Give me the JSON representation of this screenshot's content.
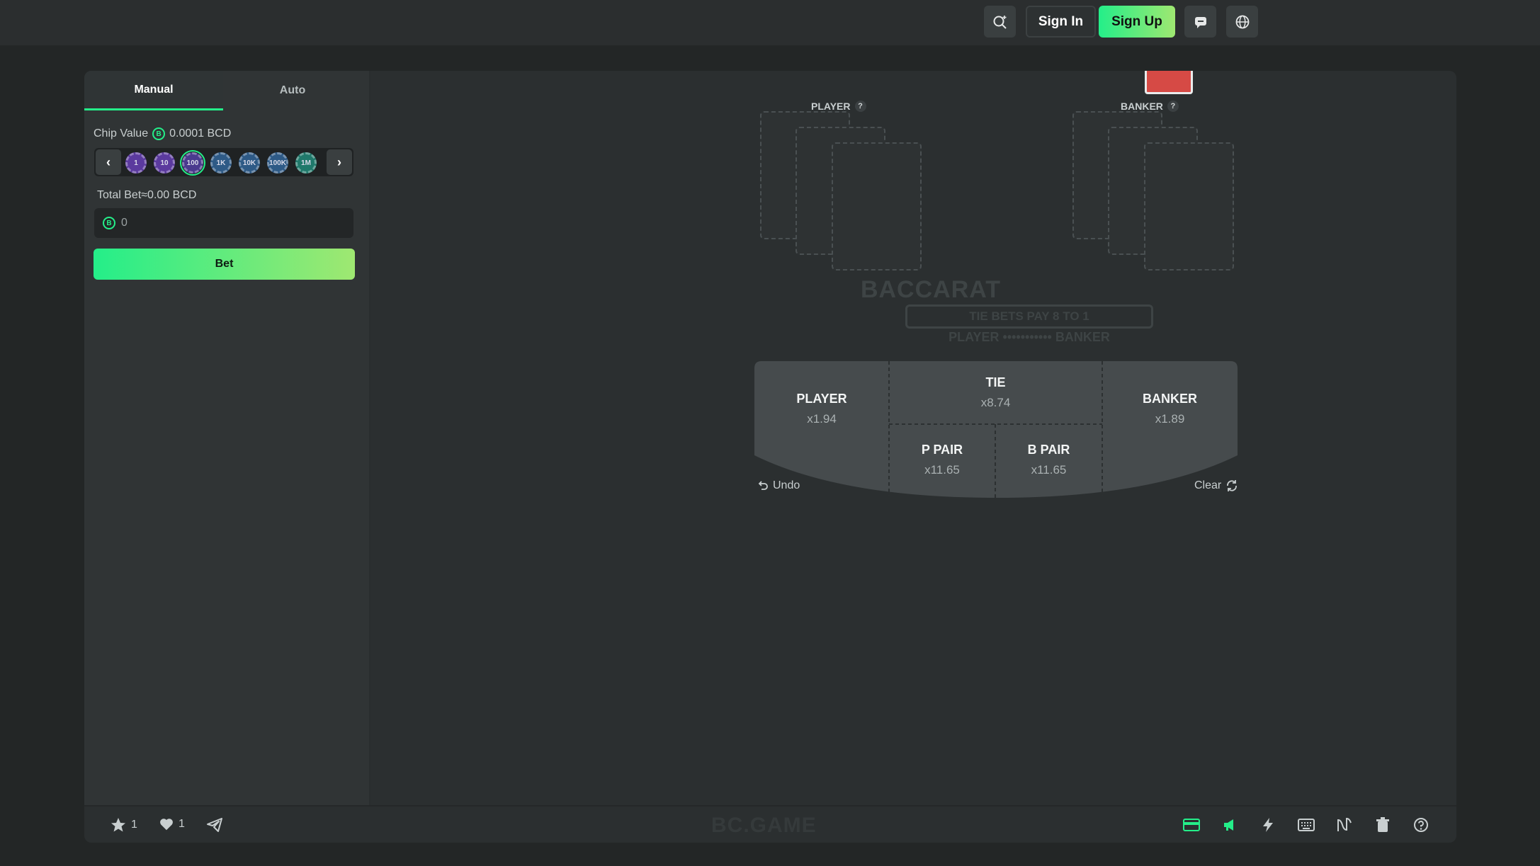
{
  "header": {
    "sign_in_label": "Sign In",
    "sign_up_label": "Sign Up",
    "icons": [
      "search-icon",
      "chat-icon",
      "globe-icon"
    ]
  },
  "sidebar": {
    "tabs": [
      {
        "label": "Manual",
        "active": true
      },
      {
        "label": "Auto",
        "active": false
      }
    ],
    "chip_value_label": "Chip Value",
    "chip_value": "0.0001 BCD",
    "chips": [
      {
        "label": "1",
        "color": "#5b3a9e"
      },
      {
        "label": "10",
        "color": "#5b3a9e"
      },
      {
        "label": "100",
        "color": "#4a3a8e",
        "selected": true
      },
      {
        "label": "1K",
        "color": "#2e5a86"
      },
      {
        "label": "10K",
        "color": "#2e5a86"
      },
      {
        "label": "100K",
        "color": "#2e5a86"
      },
      {
        "label": "1M",
        "color": "#20796b"
      }
    ],
    "total_bet_label": "Total Bet≈0.00 BCD",
    "bet_amount": "0",
    "bet_button_label": "Bet"
  },
  "table": {
    "player_label": "PLAYER",
    "banker_label": "BANKER",
    "help_mark": "?",
    "logo_title": "BACCARAT",
    "logo_ribbon": "TIE BETS PAY 8 TO 1",
    "logo_sub": "PLAYER ••••••••••• BANKER",
    "zones": {
      "player": {
        "name": "PLAYER",
        "mult": "x1.94"
      },
      "tie": {
        "name": "TIE",
        "mult": "x8.74"
      },
      "p_pair": {
        "name": "P PAIR",
        "mult": "x11.65"
      },
      "b_pair": {
        "name": "B PAIR",
        "mult": "x11.65"
      },
      "banker": {
        "name": "BANKER",
        "mult": "x1.89"
      }
    },
    "undo_label": "Undo",
    "clear_label": "Clear"
  },
  "footer": {
    "favorites_count": "1",
    "likes_count": "1",
    "brand": "BC.GAME",
    "accent": "#24ee89"
  }
}
